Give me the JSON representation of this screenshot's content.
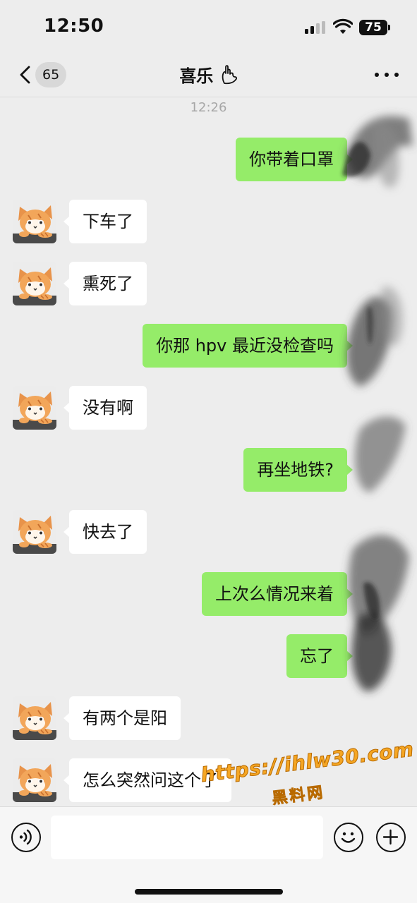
{
  "status_bar": {
    "time": "12:50",
    "battery": "75"
  },
  "nav": {
    "unread_count": "65",
    "title": "喜乐"
  },
  "chat": {
    "timestamp": "12:26",
    "messages": [
      {
        "from": "me",
        "text": "你带着口罩"
      },
      {
        "from": "them",
        "text": "下车了"
      },
      {
        "from": "them",
        "text": "熏死了"
      },
      {
        "from": "me",
        "text": "你那 hpv 最近没检查吗"
      },
      {
        "from": "them",
        "text": "没有啊"
      },
      {
        "from": "me",
        "text": "再坐地铁?"
      },
      {
        "from": "them",
        "text": "快去了"
      },
      {
        "from": "me",
        "text": "上次么情况来着"
      },
      {
        "from": "me",
        "text": "忘了"
      },
      {
        "from": "them",
        "text": "有两个是阳"
      },
      {
        "from": "them",
        "text": "怎么突然问这个了"
      }
    ]
  },
  "input": {
    "value": ""
  },
  "watermark": {
    "url": "https://ihlw30.com",
    "name": "黑料网"
  },
  "colors": {
    "outgoing_bubble": "#95ec69",
    "incoming_bubble": "#ffffff",
    "background": "#ededed"
  }
}
